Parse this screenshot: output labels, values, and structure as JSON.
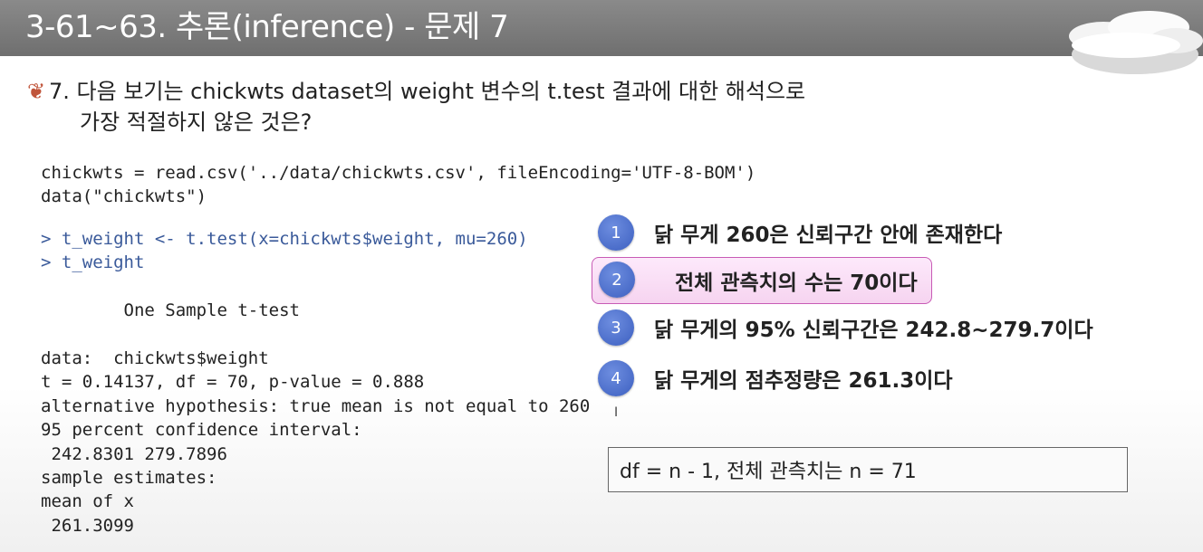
{
  "title": "3-61~63. 추론(inference) - 문제 7",
  "question": {
    "line1": "7. 다음 보기는 chickwts dataset의 weight 변수의 t.test 결과에 대한 해석으로",
    "line2": "가장 적절하지 않은 것은?"
  },
  "code": {
    "lines_a": [
      "chickwts = read.csv('../data/chickwts.csv', fileEncoding='UTF-8-BOM')",
      "data(\"chickwts\")"
    ],
    "lines_b": [
      "> t_weight <- t.test(x=chickwts$weight, mu=260)",
      "> t_weight"
    ],
    "test_title": "        One Sample t-test",
    "lines_d": [
      "data:  chickwts$weight",
      "t = 0.14137, df = 70, p-value = 0.888",
      "alternative hypothesis: true mean is not equal to 260",
      "95 percent confidence interval:",
      " 242.8301 279.7896",
      "sample estimates:",
      "mean of x",
      " 261.3099"
    ]
  },
  "options": [
    {
      "num": "1",
      "text": "닭 무게 260은 신뢰구간 안에 존재한다"
    },
    {
      "num": "2",
      "text": "전체 관측치의 수는 70이다",
      "highlighted": true
    },
    {
      "num": "3",
      "text": "닭 무게의 95% 신뢰구간은 242.8~279.7이다"
    },
    {
      "num": "4",
      "text": "닭 무게의 점추정량은 261.3이다"
    }
  ],
  "note": "df = n - 1, 전체 관측치는 n = 71",
  "colors": {
    "title_bar": "#7a7a7a",
    "option_circle": "#4a6ccc",
    "highlight_border": "#c85bb5",
    "highlight_fill": "#fbe0f6"
  }
}
